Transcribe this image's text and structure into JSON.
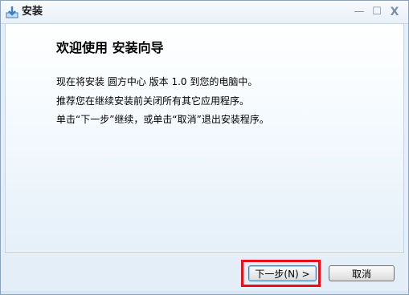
{
  "window": {
    "title": "安装",
    "icon": "installer-arrow-icon",
    "controls": {
      "minimize": "—",
      "maximize": "☐",
      "close": "X"
    }
  },
  "content": {
    "heading": "欢迎使用 安装向导",
    "line1": "现在将安装 圆方中心 版本 1.0 到您的电脑中。",
    "line2": "推荐您在继续安装前关闭所有其它应用程序。",
    "line3": "单击“下一步”继续，或单击“取消”退出安装程序。"
  },
  "buttons": {
    "next_label": "下一步(N) >",
    "cancel_label": "取消"
  },
  "colors": {
    "highlight": "#e8101a",
    "title_icon": "#3a7fc8"
  }
}
